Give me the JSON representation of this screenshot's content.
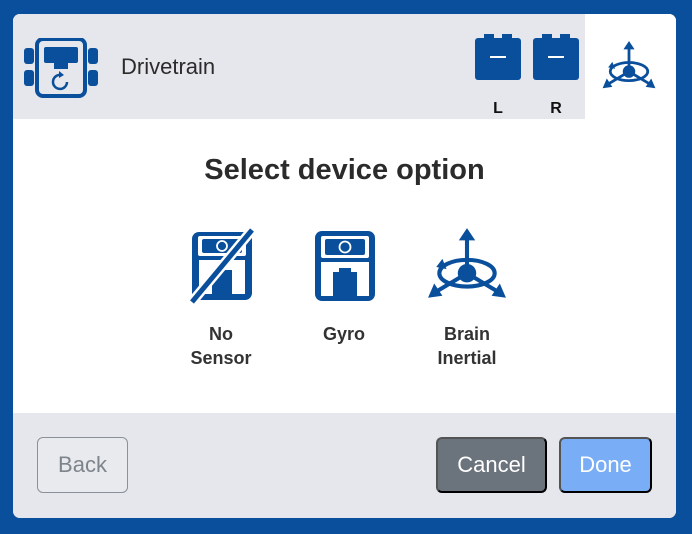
{
  "header": {
    "title": "Drivetrain",
    "motors": [
      {
        "label": "L"
      },
      {
        "label": "R"
      }
    ]
  },
  "main": {
    "heading": "Select device option",
    "options": [
      {
        "label": "No\nSensor",
        "icon": "no-sensor-icon"
      },
      {
        "label": "Gyro",
        "icon": "gyro-icon"
      },
      {
        "label": "Brain\nInertial",
        "icon": "brain-inertial-icon"
      }
    ]
  },
  "footer": {
    "back_label": "Back",
    "cancel_label": "Cancel",
    "done_label": "Done"
  },
  "colors": {
    "brand_blue": "#0a4f9c",
    "panel_gray": "#e6e7ec",
    "cancel_gray": "#6b737c",
    "done_blue": "#79aef6"
  }
}
